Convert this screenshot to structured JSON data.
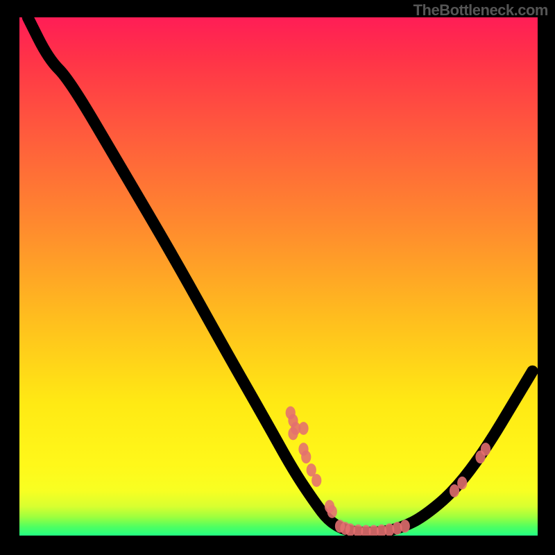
{
  "attribution": "TheBottleneck.com",
  "colors": {
    "gradient_top": "#ff1d56",
    "gradient_mid": "#ffe914",
    "gradient_bottom": "#19ff8b",
    "curve": "#000000",
    "markers": "#e46f6f",
    "axes": "#000000"
  },
  "chart_data": {
    "type": "line",
    "title": "",
    "xlabel": "",
    "ylabel": "",
    "xlim": [
      0,
      100
    ],
    "ylim": [
      0,
      100
    ],
    "curve_points": [
      {
        "x": 2,
        "y": 100
      },
      {
        "x": 6,
        "y": 92
      },
      {
        "x": 10,
        "y": 88
      },
      {
        "x": 20,
        "y": 71
      },
      {
        "x": 30,
        "y": 54
      },
      {
        "x": 40,
        "y": 36
      },
      {
        "x": 48,
        "y": 22
      },
      {
        "x": 53,
        "y": 13
      },
      {
        "x": 57,
        "y": 7
      },
      {
        "x": 60,
        "y": 3
      },
      {
        "x": 64,
        "y": 1
      },
      {
        "x": 70,
        "y": 1
      },
      {
        "x": 74,
        "y": 2
      },
      {
        "x": 78,
        "y": 4
      },
      {
        "x": 84,
        "y": 9
      },
      {
        "x": 90,
        "y": 17
      },
      {
        "x": 96,
        "y": 27
      },
      {
        "x": 99,
        "y": 32
      }
    ],
    "markers": [
      {
        "x": 52.5,
        "y": 24.0
      },
      {
        "x": 53.0,
        "y": 22.5
      },
      {
        "x": 53.5,
        "y": 21.0
      },
      {
        "x": 55.0,
        "y": 17.0
      },
      {
        "x": 55.5,
        "y": 15.5
      },
      {
        "x": 56.5,
        "y": 13.0
      },
      {
        "x": 57.5,
        "y": 11.0
      },
      {
        "x": 60.0,
        "y": 6.0
      },
      {
        "x": 60.5,
        "y": 5.0
      },
      {
        "x": 55.0,
        "y": 21.0
      },
      {
        "x": 53.0,
        "y": 20.0
      },
      {
        "x": 62.0,
        "y": 2.2
      },
      {
        "x": 63.0,
        "y": 1.8
      },
      {
        "x": 64.0,
        "y": 1.5
      },
      {
        "x": 65.5,
        "y": 1.3
      },
      {
        "x": 67.0,
        "y": 1.2
      },
      {
        "x": 68.5,
        "y": 1.2
      },
      {
        "x": 70.0,
        "y": 1.3
      },
      {
        "x": 71.5,
        "y": 1.5
      },
      {
        "x": 73.0,
        "y": 1.8
      },
      {
        "x": 74.5,
        "y": 2.2
      },
      {
        "x": 84.0,
        "y": 9.0
      },
      {
        "x": 85.5,
        "y": 10.5
      },
      {
        "x": 89.0,
        "y": 15.5
      },
      {
        "x": 90.0,
        "y": 17.0
      }
    ]
  }
}
